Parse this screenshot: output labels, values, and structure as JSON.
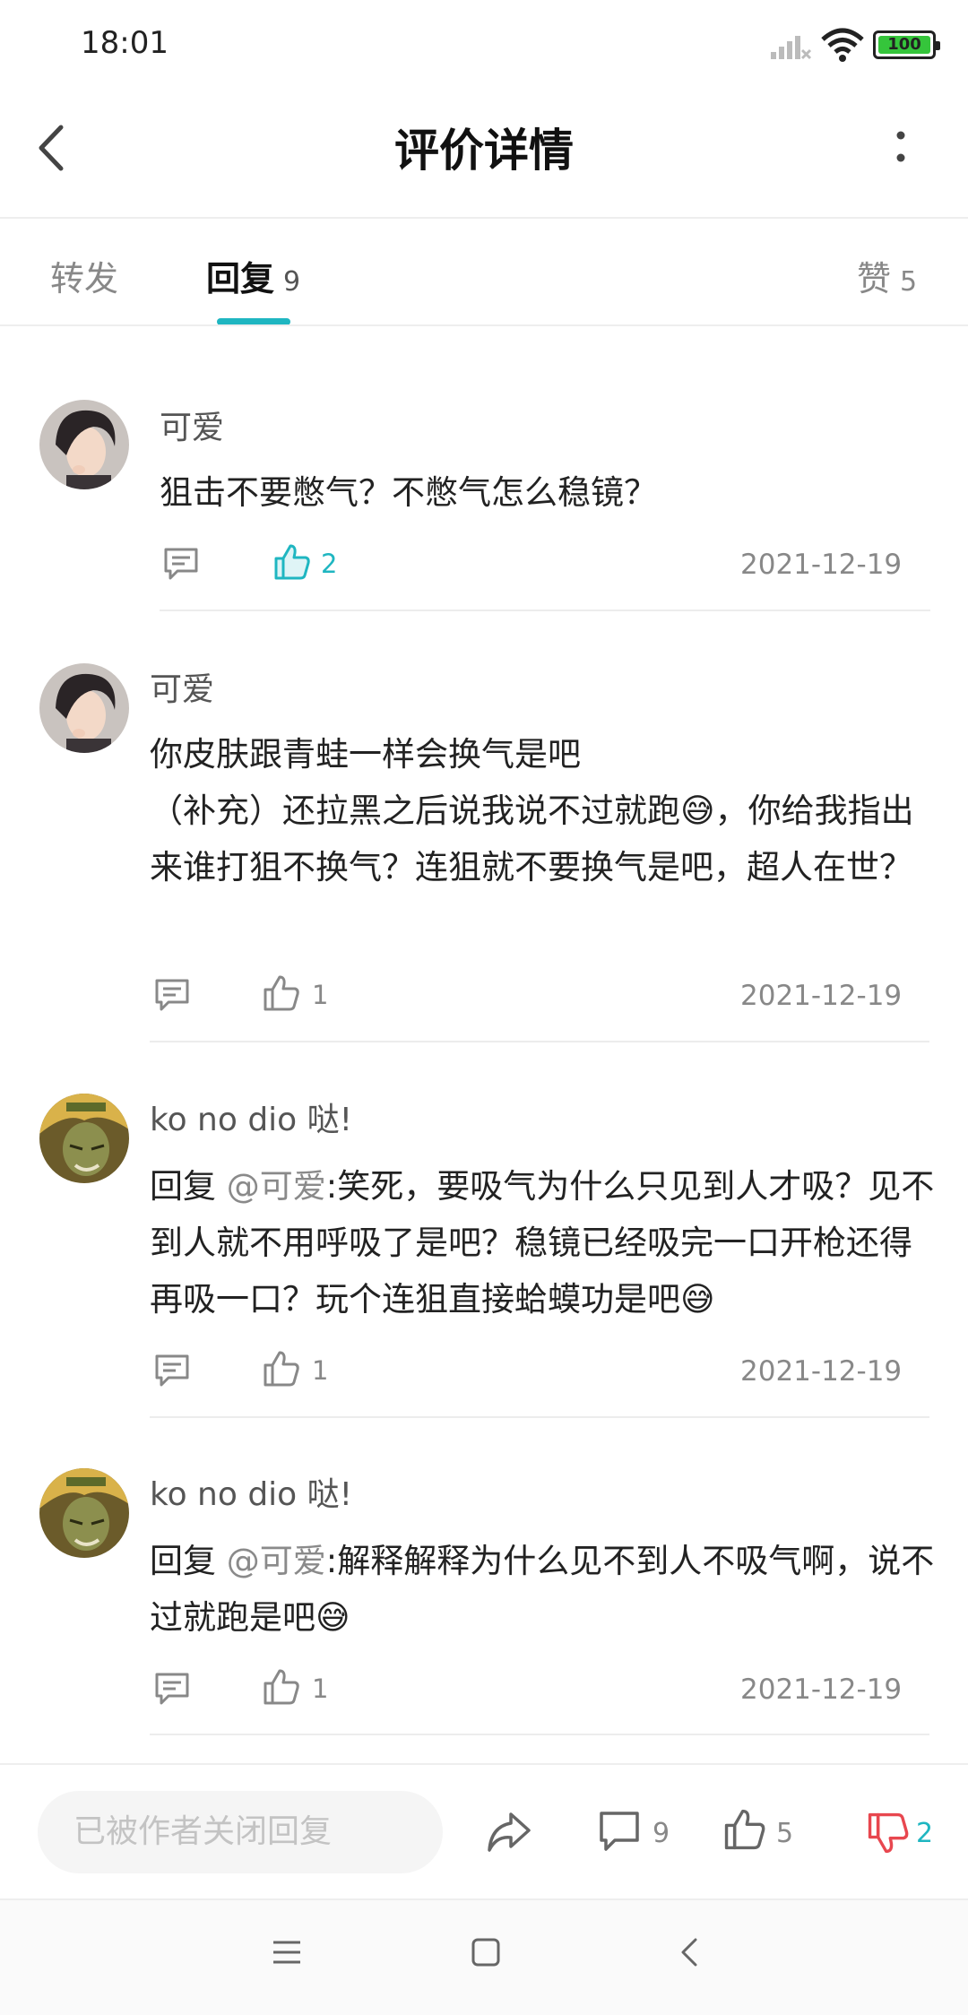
{
  "status_bar": {
    "time": "18:01",
    "battery": "100"
  },
  "header": {
    "title": "评价详情"
  },
  "tabs": [
    {
      "label": "转发",
      "count": ""
    },
    {
      "label": "回复",
      "count": "9"
    },
    {
      "label": "赞",
      "count": "5"
    }
  ],
  "comments": [
    {
      "username": "可爱",
      "text": "狙击不要憋气？不憋气怎么稳镜？",
      "likes": "2",
      "date": "2021-12-19"
    },
    {
      "username": "可爱",
      "line1": "你皮肤跟青蛙一样会换气是吧",
      "line2": "（补充）还拉黑之后说我说不过就跑",
      "line3": "，你给我指出来谁打狙不换气？连狙就不要换气是吧，超人在世？",
      "likes": "1",
      "date": "2021-12-19"
    },
    {
      "username": "ko no dio 哒!",
      "reply_prefix": "回复 ",
      "mention": "@可爱",
      "text": ":笑死，要吸气为什么只见到人才吸？见不到人就不用呼吸了是吧？稳镜已经吸完一口开枪还得再吸一口？玩个连狙直接蛤蟆功是吧",
      "likes": "1",
      "date": "2021-12-19"
    },
    {
      "username": "ko no dio 哒!",
      "reply_prefix": "回复 ",
      "mention": "@可爱",
      "text": ":解释解释为什么见不到人不吸气啊，说不过就跑是吧",
      "likes": "1",
      "date": "2021-12-19"
    }
  ],
  "bottom_bar": {
    "reply_placeholder": "已被作者关闭回复",
    "comment_count": "9",
    "like_count": "5",
    "dislike_count": "2"
  },
  "colors": {
    "accent": "#1fb6c1",
    "dislike": "#e8474f"
  },
  "icons": [
    "back-icon",
    "more-icon",
    "comment-icon",
    "thumbs-up-icon",
    "share-icon",
    "thumbs-down-icon",
    "menu-icon",
    "home-icon",
    "nav-back-icon",
    "sweat-smile-emoji"
  ]
}
